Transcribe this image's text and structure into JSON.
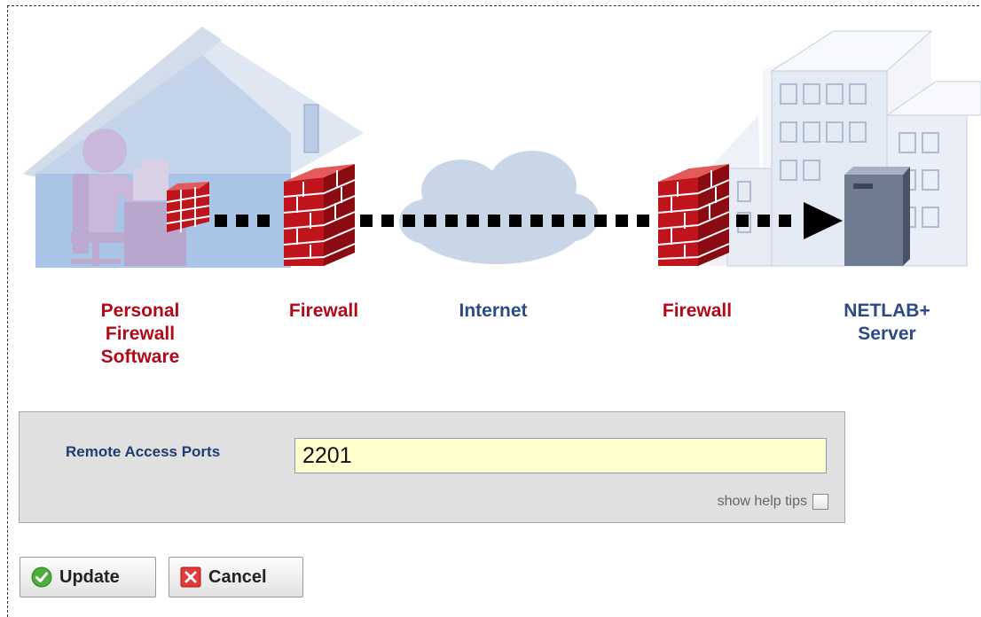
{
  "diagram": {
    "labels": {
      "personal_firewall": "Personal\nFirewall\nSoftware",
      "firewall_left": "Firewall",
      "internet": "Internet",
      "firewall_right": "Firewall",
      "server": "NETLAB+\nServer"
    }
  },
  "form": {
    "field_label": "Remote Access Ports",
    "field_value": "2201",
    "help_tips_label": "show help tips",
    "help_tips_checked": false
  },
  "buttons": {
    "update": "Update",
    "cancel": "Cancel"
  },
  "colors": {
    "label_red": "#b00a1a",
    "label_blue": "#2b4a86",
    "input_bg": "#ffffcc",
    "panel_bg": "#e0e0e0"
  }
}
